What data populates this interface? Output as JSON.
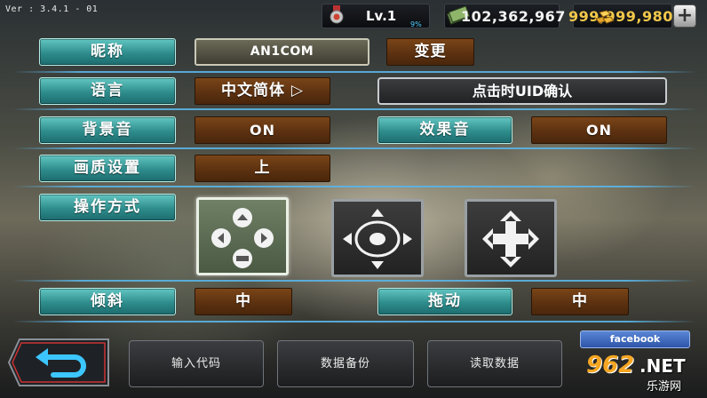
{
  "version": "Ver : 3.4.1 - 01",
  "status_bar": {
    "level": "Lv.1",
    "level_progress": "9%",
    "cash": "102,362,967",
    "gold": "999,999,980",
    "add_icon": "plus-icon"
  },
  "settings": {
    "nickname": {
      "label": "昵称",
      "value": "AN1COM",
      "action": "变更"
    },
    "language": {
      "label": "语言",
      "value": "中文简体 ▷",
      "uid_button": "点击时UID确认"
    },
    "bgm": {
      "label": "背景音",
      "value": "ON"
    },
    "sfx": {
      "label": "效果音",
      "value": "ON"
    },
    "quality": {
      "label": "画质设置",
      "value": "上"
    },
    "control": {
      "label": "操作方式",
      "options": [
        "button-pad-icon",
        "analog-stick-icon",
        "dpad-icon"
      ],
      "selected": 0
    },
    "tilt": {
      "label": "倾斜",
      "value": "中"
    },
    "drag": {
      "label": "拖动",
      "value": "中"
    }
  },
  "bottom": {
    "back_icon": "back-arrow-icon",
    "enter_code": "输入代码",
    "backup": "数据备份",
    "load": "读取数据",
    "facebook": "facebook"
  },
  "watermark": {
    "brand": "962",
    "brand_suffix": ".NET",
    "sub": "乐游网"
  },
  "colors": {
    "label_teal": "#2e8d8c",
    "value_brown": "#5a3010",
    "accent_blue": "#4fd0ff",
    "gold": "#f2c84a"
  }
}
